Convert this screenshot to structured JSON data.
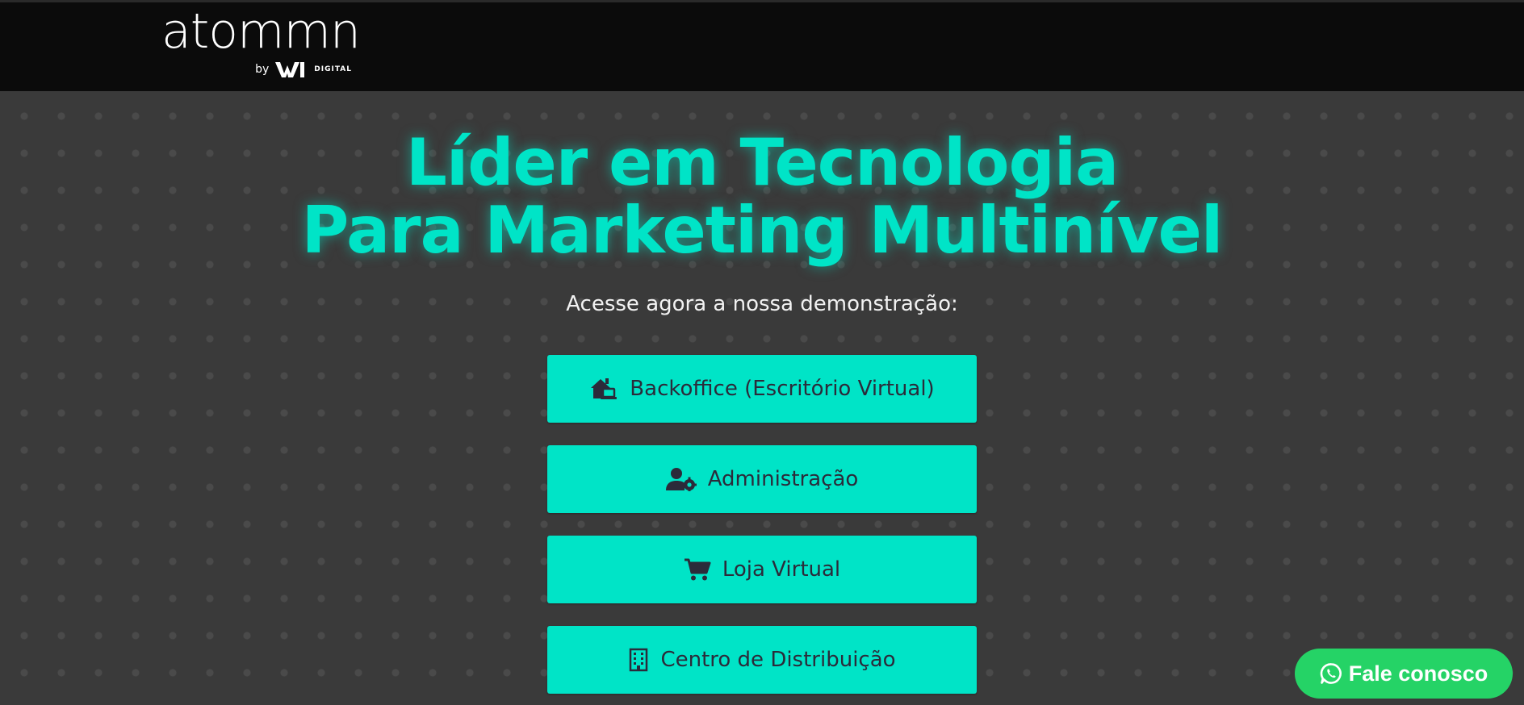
{
  "header": {
    "logo": {
      "wordmark": "atommn",
      "by": "by",
      "brand_mark": "W",
      "digital": "DIGITAL"
    }
  },
  "hero": {
    "headline_line1": "Líder em Tecnologia",
    "headline_line2": "Para Marketing Multinível",
    "subtitle": "Acesse agora a nossa demonstração:"
  },
  "buttons": [
    {
      "label": "Backoffice (Escritório Virtual)",
      "icon": "house-laptop-icon"
    },
    {
      "label": "Administração",
      "icon": "user-gear-icon"
    },
    {
      "label": "Loja Virtual",
      "icon": "cart-icon"
    },
    {
      "label": "Centro de Distribuição",
      "icon": "building-icon"
    }
  ],
  "contact_fab": {
    "label": "Fale conosco",
    "icon": "whatsapp-icon"
  },
  "colors": {
    "accent": "#00e4c7",
    "header_bg": "#0b0b0b",
    "page_bg": "#3a3a3a",
    "whatsapp": "#25d366",
    "button_text": "#2b2b3a"
  }
}
